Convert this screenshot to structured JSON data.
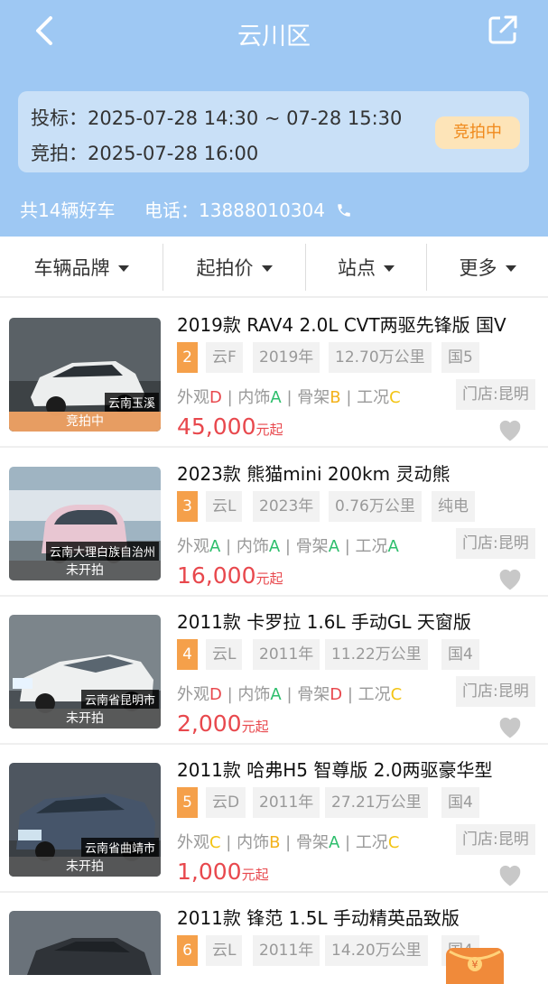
{
  "header": {
    "title": "云川区"
  },
  "auction": {
    "bid_label": "投标：",
    "bid_time": "2025-07-28 14:30 ~ 07-28 15:30",
    "auction_label": "竞拍：",
    "auction_time": "2025-07-28 16:00",
    "status": "竞拍中"
  },
  "summary": {
    "count": "共14辆好车",
    "phone_label": "电话：",
    "phone": "13888010304"
  },
  "filters": [
    {
      "label": "车辆品牌"
    },
    {
      "label": "起拍价"
    },
    {
      "label": "站点"
    },
    {
      "label": "更多"
    }
  ],
  "listings": [
    {
      "title": "2019款 RAV4 2.0L CVT两驱先锋版 国V",
      "index": "2",
      "plate": "云F",
      "year": "2019年",
      "mileage": "12.70万公里",
      "extra": "国5",
      "exterior": "D",
      "interior": "A",
      "frame": "B",
      "condition": "C",
      "store": "门店:昆明",
      "price": "45,000",
      "price_unit": "元起",
      "location": "云南玉溪",
      "status": "竞拍中"
    },
    {
      "title": "2023款 熊猫mini 200km 灵动熊",
      "index": "3",
      "plate": "云L",
      "year": "2023年",
      "mileage": "0.76万公里",
      "extra": "纯电",
      "exterior": "A",
      "interior": "A",
      "frame": "A",
      "condition": "A",
      "store": "门店:昆明",
      "price": "16,000",
      "price_unit": "元起",
      "location": "云南大理白族自治州",
      "status": "未开拍"
    },
    {
      "title": "2011款 卡罗拉 1.6L 手动GL 天窗版",
      "index": "4",
      "plate": "云L",
      "year": "2011年",
      "mileage": "11.22万公里",
      "extra": "国4",
      "exterior": "D",
      "interior": "A",
      "frame": "D",
      "condition": "C",
      "store": "门店:昆明",
      "price": "2,000",
      "price_unit": "元起",
      "location": "云南省昆明市",
      "status": "未开拍"
    },
    {
      "title": "2011款 哈弗H5 智尊版 2.0两驱豪华型",
      "index": "5",
      "plate": "云D",
      "year": "2011年",
      "mileage": "27.21万公里",
      "extra": "国4",
      "exterior": "C",
      "interior": "B",
      "frame": "A",
      "condition": "C",
      "store": "门店:昆明",
      "price": "1,000",
      "price_unit": "元起",
      "location": "云南省曲靖市",
      "status": "未开拍"
    },
    {
      "title": "2011款 锋范 1.5L 手动精英品致版",
      "index": "6",
      "plate": "云L",
      "year": "2011年",
      "mileage": "14.20万公里",
      "extra": "国4"
    }
  ],
  "grade_labels": {
    "exterior": "外观",
    "interior": "内饰",
    "frame": "骨架",
    "condition": "工况"
  },
  "colors": {
    "header_bg": "#9ec8f3",
    "price": "#e8484d",
    "badge": "#f5a04a",
    "grade_A": "#2dbe6c",
    "grade_B": "#f3b21b",
    "grade_C": "#f3c414",
    "grade_D": "#e8484d"
  }
}
